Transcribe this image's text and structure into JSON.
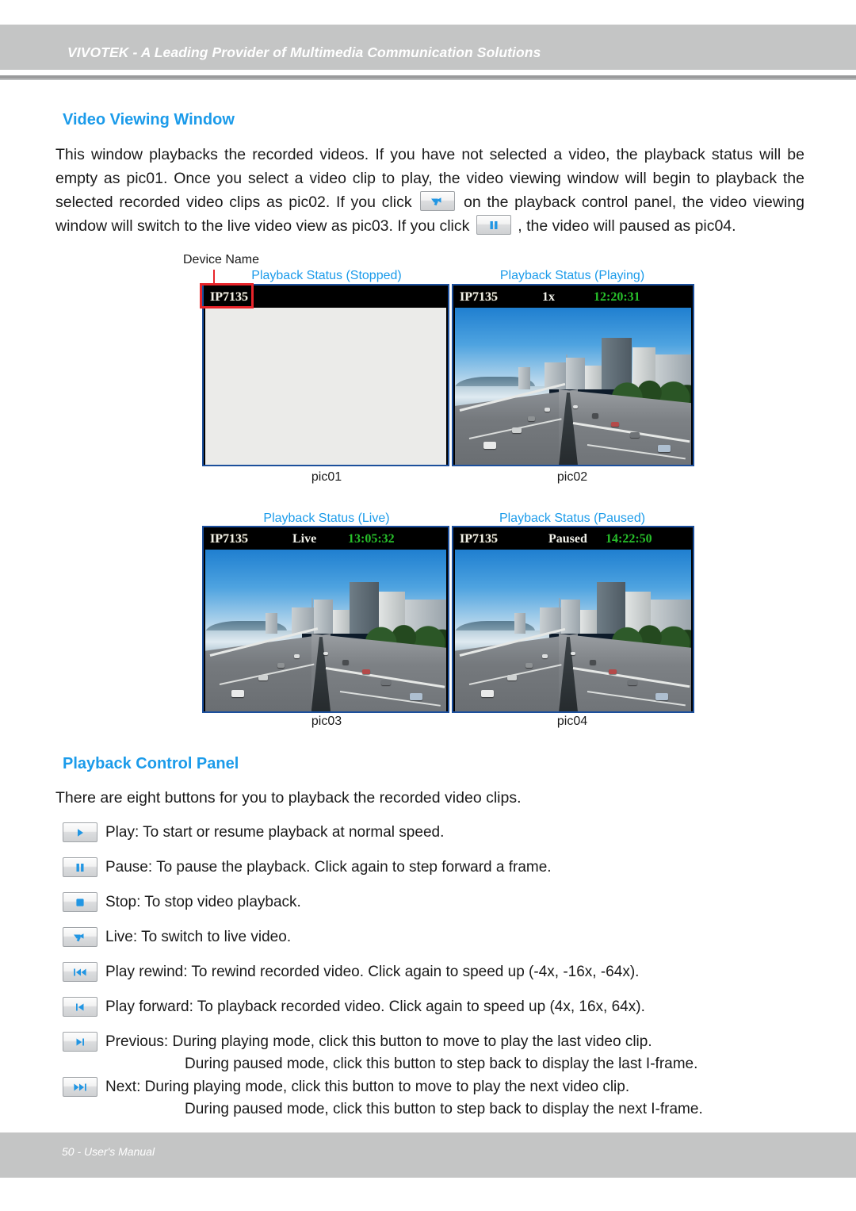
{
  "header": {
    "title": "VIVOTEK - A Leading Provider of Multimedia Communication Solutions"
  },
  "footer": {
    "text": "50 - User's Manual"
  },
  "sections": {
    "video_viewing_window": {
      "heading": "Video Viewing Window",
      "paragraph_part1": "This window playbacks the recorded videos. If you have not selected a video, the playback status will be empty as pic01. Once you select a video clip to play, the video viewing window will begin to playback the selected recorded video clips as pic02. If you click",
      "paragraph_part2": "on the playback control panel, the video viewing window will switch to the live video view as pic03. If you click",
      "paragraph_part3": ", the video will paused as pic04."
    },
    "playback_control_panel": {
      "heading": "Playback Control Panel",
      "intro": "There are eight buttons for you to playback the recorded video clips."
    }
  },
  "figure": {
    "device_name_annotation": "Device Name",
    "panels": [
      {
        "status_caption": "Playback Status (Stopped)",
        "caption": "pic01",
        "device_name": "IP7135",
        "mode": "",
        "time": "",
        "empty": true
      },
      {
        "status_caption": "Playback Status (Playing)",
        "caption": "pic02",
        "device_name": "IP7135",
        "mode": "1x",
        "time": "12:20:31",
        "empty": false
      },
      {
        "status_caption": "Playback Status (Live)",
        "caption": "pic03",
        "device_name": "IP7135",
        "mode": "Live",
        "time": "13:05:32",
        "empty": false
      },
      {
        "status_caption": "Playback Status (Paused)",
        "caption": "pic04",
        "device_name": "IP7135",
        "mode": "Paused",
        "time": "14:22:50",
        "empty": false
      }
    ]
  },
  "buttons": [
    {
      "icon": "play-icon",
      "label": "Play: To start or resume playback at normal speed.",
      "sub": ""
    },
    {
      "icon": "pause-icon",
      "label": "Pause: To pause the playback. Click again to step forward a frame.",
      "sub": ""
    },
    {
      "icon": "stop-icon",
      "label": "Stop: To stop video playback.",
      "sub": ""
    },
    {
      "icon": "live-camera-icon",
      "label": "Live: To switch to live video.",
      "sub": ""
    },
    {
      "icon": "play-rewind-icon",
      "label": "Play rewind: To rewind recorded video. Click again to speed up (-4x, -16x, -64x).",
      "sub": ""
    },
    {
      "icon": "play-forward-icon",
      "label": "Play forward: To playback recorded video. Click again to speed up (4x, 16x, 64x).",
      "sub": ""
    },
    {
      "icon": "previous-icon",
      "label": "Previous: During playing mode, click this button to move to play the last video clip.",
      "sub": "During paused mode, click this button to step back to display the last I-frame."
    },
    {
      "icon": "next-icon",
      "label": "Next: During playing mode, click this button to move to play the next video clip.",
      "sub": "During paused mode, click this button to step back to display the next I-frame."
    }
  ],
  "colors": {
    "heading_blue": "#1b9bea",
    "band_gray": "#c4c5c5",
    "annotation_red": "#e8242a",
    "window_border_blue": "#1c4f9c",
    "osd_time_green": "#27c02a"
  }
}
